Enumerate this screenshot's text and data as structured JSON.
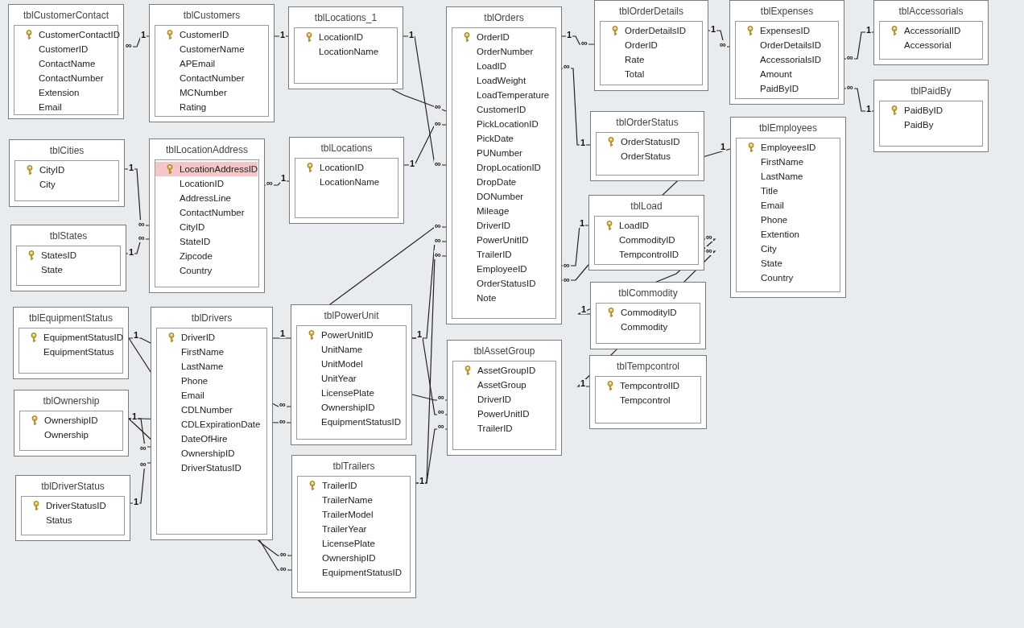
{
  "tables": [
    {
      "title": "tblCustomerContact",
      "fields": [
        {
          "name": "CustomerContactID",
          "key": true,
          "selected": false
        },
        {
          "name": "CustomerID",
          "selected": false
        },
        {
          "name": "ContactName",
          "selected": false
        },
        {
          "name": "ContactNumber",
          "selected": false
        },
        {
          "name": "Extension",
          "selected": false
        },
        {
          "name": "Email",
          "selected": false
        }
      ]
    },
    {
      "title": "tblCustomers",
      "fields": [
        {
          "name": "CustomerID",
          "key": true,
          "selected": false
        },
        {
          "name": "CustomerName",
          "selected": false
        },
        {
          "name": "APEmail",
          "selected": false
        },
        {
          "name": "ContactNumber",
          "selected": false
        },
        {
          "name": "MCNumber",
          "selected": false
        },
        {
          "name": "Rating",
          "selected": false
        }
      ]
    },
    {
      "title": "tblLocations_1",
      "fields": [
        {
          "name": "LocationID",
          "key": true,
          "selected": false
        },
        {
          "name": "LocationName",
          "selected": false
        }
      ]
    },
    {
      "title": "tblOrders",
      "fields": [
        {
          "name": "OrderID",
          "key": true,
          "selected": false
        },
        {
          "name": "OrderNumber",
          "selected": false
        },
        {
          "name": "LoadID",
          "selected": false
        },
        {
          "name": "LoadWeight",
          "selected": false
        },
        {
          "name": "LoadTemperature",
          "selected": false
        },
        {
          "name": "CustomerID",
          "selected": false
        },
        {
          "name": "PickLocationID",
          "selected": false
        },
        {
          "name": "PickDate",
          "selected": false
        },
        {
          "name": "PUNumber",
          "selected": false
        },
        {
          "name": "DropLocationID",
          "selected": false
        },
        {
          "name": "DropDate",
          "selected": false
        },
        {
          "name": "DONumber",
          "selected": false
        },
        {
          "name": "Mileage",
          "selected": false
        },
        {
          "name": "DriverID",
          "selected": false
        },
        {
          "name": "PowerUnitID",
          "selected": false
        },
        {
          "name": "TrailerID",
          "selected": false
        },
        {
          "name": "EmployeeID",
          "selected": false
        },
        {
          "name": "OrderStatusID",
          "selected": false
        },
        {
          "name": "Note",
          "selected": false
        }
      ]
    },
    {
      "title": "tblOrderDetails",
      "fields": [
        {
          "name": "OrderDetailsID",
          "key": true,
          "selected": false
        },
        {
          "name": "OrderID",
          "selected": false
        },
        {
          "name": "Rate",
          "selected": false
        },
        {
          "name": "Total",
          "selected": false
        }
      ]
    },
    {
      "title": "tblExpenses",
      "fields": [
        {
          "name": "ExpensesID",
          "key": true,
          "selected": false
        },
        {
          "name": "OrderDetailsID",
          "selected": false
        },
        {
          "name": "AccessorialsID",
          "selected": false
        },
        {
          "name": "Amount",
          "selected": false
        },
        {
          "name": "PaidByID",
          "selected": false
        }
      ]
    },
    {
      "title": "tblAccessorials",
      "fields": [
        {
          "name": "AccessorialID",
          "key": true,
          "selected": false
        },
        {
          "name": "Accessorial",
          "selected": false
        }
      ]
    },
    {
      "title": "tblPaidBy",
      "fields": [
        {
          "name": "PaidByID",
          "key": true,
          "selected": false
        },
        {
          "name": "PaidBy",
          "selected": false
        }
      ]
    },
    {
      "title": "tblCities",
      "fields": [
        {
          "name": "CityID",
          "key": true,
          "selected": false
        },
        {
          "name": "City",
          "selected": false
        }
      ]
    },
    {
      "title": "tblLocationAddress",
      "fields": [
        {
          "name": "LocationAddressID",
          "key": true,
          "selected": true
        },
        {
          "name": "LocationID",
          "selected": false
        },
        {
          "name": "AddressLine",
          "selected": false
        },
        {
          "name": "ContactNumber",
          "selected": false
        },
        {
          "name": "CityID",
          "selected": false
        },
        {
          "name": "StateID",
          "selected": false
        },
        {
          "name": "Zipcode",
          "selected": false
        },
        {
          "name": "Country",
          "selected": false
        }
      ]
    },
    {
      "title": "tblLocations",
      "fields": [
        {
          "name": "LocationID",
          "key": true,
          "selected": false
        },
        {
          "name": "LocationName",
          "selected": false
        }
      ]
    },
    {
      "title": "tblOrderStatus",
      "fields": [
        {
          "name": "OrderStatusID",
          "key": true,
          "selected": false
        },
        {
          "name": "OrderStatus",
          "selected": false
        }
      ]
    },
    {
      "title": "tblEmployees",
      "fields": [
        {
          "name": "EmployeesID",
          "key": true,
          "selected": false
        },
        {
          "name": "FirstName",
          "selected": false
        },
        {
          "name": "LastName",
          "selected": false
        },
        {
          "name": "Title",
          "selected": false
        },
        {
          "name": "Email",
          "selected": false
        },
        {
          "name": "Phone",
          "selected": false
        },
        {
          "name": "Extention",
          "selected": false
        },
        {
          "name": "City",
          "selected": false
        },
        {
          "name": "State",
          "selected": false
        },
        {
          "name": "Country",
          "selected": false
        }
      ]
    },
    {
      "title": "tblStates",
      "fields": [
        {
          "name": "StatesID",
          "key": true,
          "selected": false
        },
        {
          "name": "State",
          "selected": false
        }
      ]
    },
    {
      "title": "tblLoad",
      "fields": [
        {
          "name": "LoadID",
          "key": true,
          "selected": false
        },
        {
          "name": "CommodityID",
          "selected": false
        },
        {
          "name": "TempcontrolID",
          "selected": false
        }
      ]
    },
    {
      "title": "tblCommodity",
      "fields": [
        {
          "name": "CommodityID",
          "key": true,
          "selected": false
        },
        {
          "name": "Commodity",
          "selected": false
        }
      ]
    },
    {
      "title": "tblEquipmentStatus",
      "fields": [
        {
          "name": "EquipmentStatusID",
          "key": true,
          "selected": false
        },
        {
          "name": "EquipmentStatus",
          "selected": false
        }
      ]
    },
    {
      "title": "tblDrivers",
      "fields": [
        {
          "name": "DriverID",
          "key": true,
          "selected": false
        },
        {
          "name": "FirstName",
          "selected": false
        },
        {
          "name": "LastName",
          "selected": false
        },
        {
          "name": "Phone",
          "selected": false
        },
        {
          "name": "Email",
          "selected": false
        },
        {
          "name": "CDLNumber",
          "selected": false
        },
        {
          "name": "CDLExpirationDate",
          "selected": false
        },
        {
          "name": "DateOfHire",
          "selected": false
        },
        {
          "name": "OwnershipID",
          "selected": false
        },
        {
          "name": "DriverStatusID",
          "selected": false
        }
      ]
    },
    {
      "title": "tblPowerUnit",
      "fields": [
        {
          "name": "PowerUnitID",
          "key": true,
          "selected": false
        },
        {
          "name": "UnitName",
          "selected": false
        },
        {
          "name": "UnitModel",
          "selected": false
        },
        {
          "name": "UnitYear",
          "selected": false
        },
        {
          "name": "LicensePlate",
          "selected": false
        },
        {
          "name": "OwnershipID",
          "selected": false
        },
        {
          "name": "EquipmentStatusID",
          "selected": false
        }
      ]
    },
    {
      "title": "tblAssetGroup",
      "fields": [
        {
          "name": "AssetGroupID",
          "key": true,
          "selected": false
        },
        {
          "name": "AssetGroup",
          "selected": false
        },
        {
          "name": "DriverID",
          "selected": false
        },
        {
          "name": "PowerUnitID",
          "selected": false
        },
        {
          "name": "TrailerID",
          "selected": false
        }
      ]
    },
    {
      "title": "tblTempcontrol",
      "fields": [
        {
          "name": "TempcontrolID",
          "key": true,
          "selected": false
        },
        {
          "name": "Tempcontrol",
          "selected": false
        }
      ]
    },
    {
      "title": "tblOwnership",
      "fields": [
        {
          "name": "OwnershipID",
          "key": true,
          "selected": false
        },
        {
          "name": "Ownership",
          "selected": false
        }
      ]
    },
    {
      "title": "tblTrailers",
      "fields": [
        {
          "name": "TrailerID",
          "key": true,
          "selected": false
        },
        {
          "name": "TrailerName",
          "selected": false
        },
        {
          "name": "TrailerModel",
          "selected": false
        },
        {
          "name": "TrailerYear",
          "selected": false
        },
        {
          "name": "LicensePlate",
          "selected": false
        },
        {
          "name": "OwnershipID",
          "selected": false
        },
        {
          "name": "EquipmentStatusID",
          "selected": false
        }
      ]
    },
    {
      "title": "tblDriverStatus",
      "fields": [
        {
          "name": "DriverStatusID",
          "key": true,
          "selected": false
        },
        {
          "name": "Status",
          "selected": false
        }
      ]
    }
  ],
  "relationships": [
    {
      "one": "1",
      "many": "∞"
    },
    {
      "one": "1",
      "many": "∞"
    },
    {
      "one": "1",
      "many": "∞"
    },
    {
      "one": "1",
      "many": "∞"
    },
    {
      "one": "1",
      "many": "∞"
    },
    {
      "one": "1",
      "many": "∞"
    },
    {
      "one": "1",
      "many": "∞"
    },
    {
      "one": "1",
      "many": "∞"
    },
    {
      "one": "1",
      "many": "∞"
    },
    {
      "one": "1",
      "many": "∞"
    },
    {
      "one": "1",
      "many": "∞"
    },
    {
      "one": "1",
      "many": "∞"
    },
    {
      "one": "1",
      "many": "∞"
    },
    {
      "one": "1",
      "many": "∞"
    },
    {
      "one": "1",
      "many": "∞"
    },
    {
      "one": "1",
      "many": "∞"
    },
    {
      "one": "1",
      "many": "∞"
    },
    {
      "one": "1",
      "many": "∞"
    },
    {
      "one": "1",
      "many": "∞"
    },
    {
      "many": "∞"
    },
    {
      "many": "∞"
    },
    {
      "many": "∞"
    },
    {
      "one": "1",
      "many": "∞"
    },
    {
      "one": "1",
      "many": "∞"
    },
    {
      "many": "∞"
    },
    {
      "one": "1",
      "many": "∞"
    },
    {
      "many": "∞"
    },
    {
      "many": "∞"
    }
  ]
}
